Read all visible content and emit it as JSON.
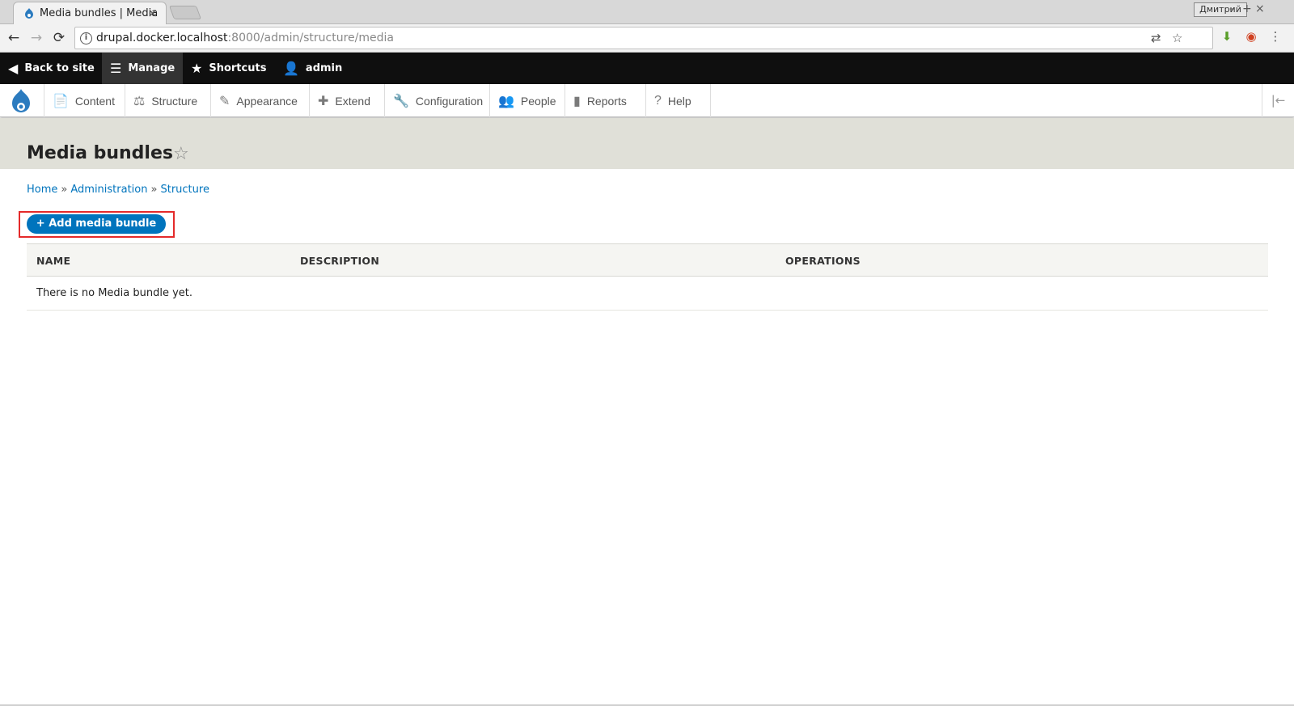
{
  "browser": {
    "tab_title": "Media bundles | Media",
    "profile_name": "Дмитрий",
    "url_host": "drupal.docker.localhost",
    "url_rest": ":8000/admin/structure/media"
  },
  "toolbar": {
    "back_to_site": "Back to site",
    "manage": "Manage",
    "shortcuts": "Shortcuts",
    "user": "admin"
  },
  "tray": {
    "items": [
      "Content",
      "Structure",
      "Appearance",
      "Extend",
      "Configuration",
      "People",
      "Reports",
      "Help"
    ]
  },
  "page": {
    "title": "Media bundles",
    "breadcrumb": [
      "Home",
      "Administration",
      "Structure"
    ],
    "breadcrumb_sep": "»",
    "add_button": "+ Add media bundle"
  },
  "table": {
    "headers": [
      "NAME",
      "DESCRIPTION",
      "OPERATIONS"
    ],
    "empty_message": "There is no Media bundle yet."
  },
  "colors": {
    "accent": "#0074bd",
    "highlight": "#e42a2a",
    "toolbar_bg": "#0f0f0f"
  }
}
